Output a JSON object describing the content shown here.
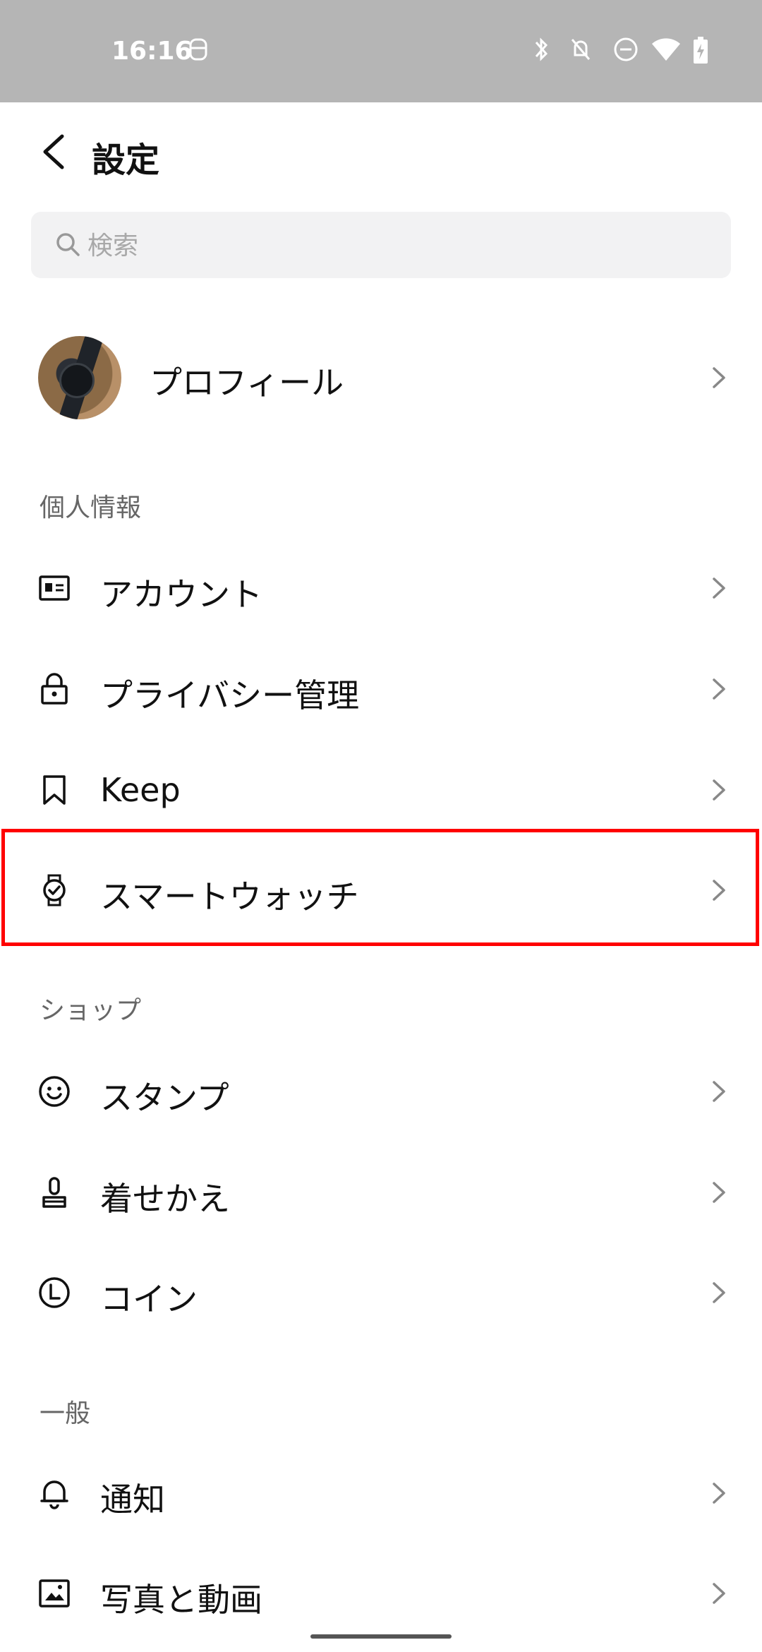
{
  "status_bar": {
    "time": "16:16"
  },
  "header": {
    "title": "設定"
  },
  "search": {
    "placeholder": "検索"
  },
  "profile": {
    "label": "プロフィール"
  },
  "sections": {
    "personal": "個人情報",
    "shop": "ショップ",
    "general": "一般"
  },
  "items": {
    "account": "アカウント",
    "privacy": "プライバシー管理",
    "keep": "Keep",
    "smartwatch": "スマートウォッチ",
    "stamp": "スタンプ",
    "theme": "着せかえ",
    "coin": "コイン",
    "notification": "通知",
    "photo_video": "写真と動画"
  },
  "colors": {
    "highlight": "#ff0000",
    "status_bar": "#b5b5b5"
  }
}
